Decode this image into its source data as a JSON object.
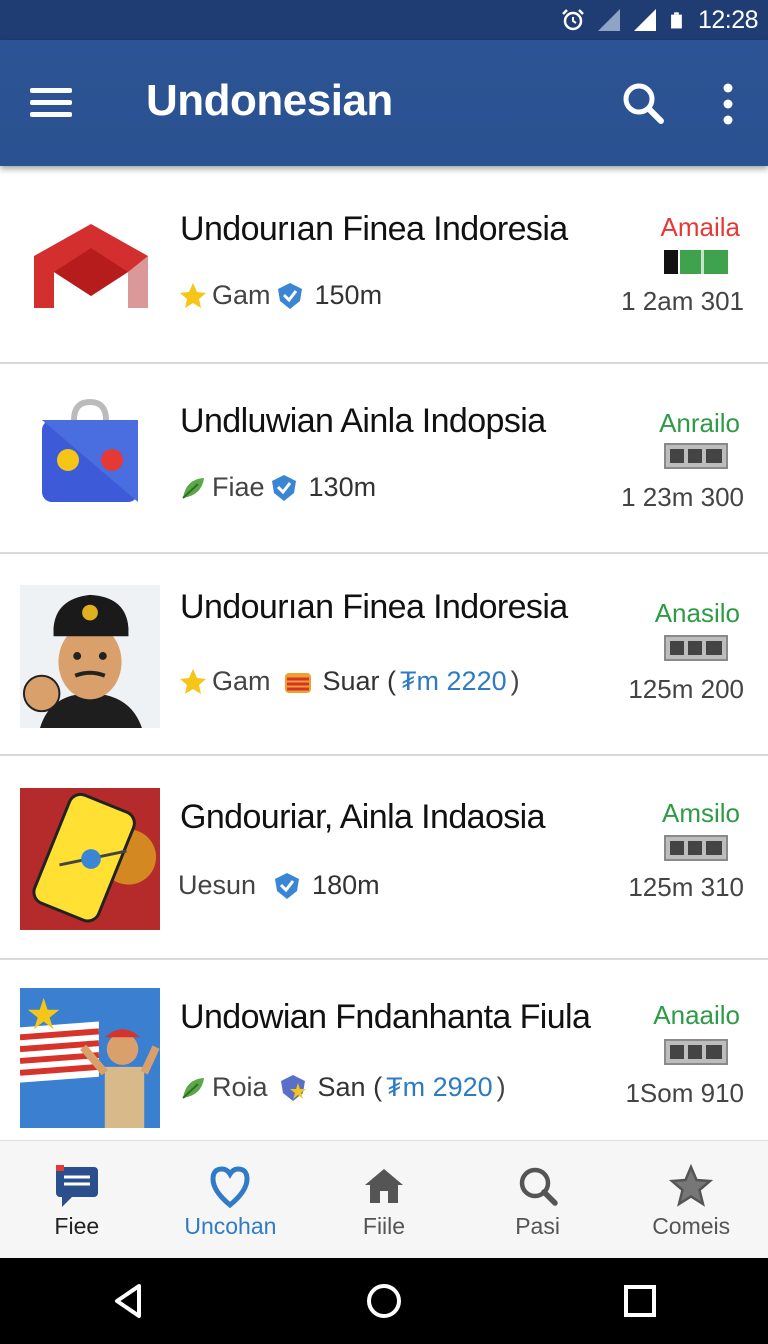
{
  "status_bar": {
    "time": "12:28"
  },
  "app_bar": {
    "title": "Undonesian"
  },
  "colors": {
    "app_bar": "#2a5190",
    "status_bar": "#1f3c73",
    "status_red": "#e53935",
    "status_green": "#2e9b46",
    "nav_selected": "#2f7bc8"
  },
  "items": [
    {
      "title": "Undourıan Finea Indoresia",
      "meta_left_icon": "star-icon",
      "meta_left_text": "Gam",
      "meta_mid_icon": "verified-check-icon",
      "meta_count": "150m",
      "meta_extra": "",
      "status": "Amaila",
      "status_color": "#e53935",
      "sizes": "1 2am 301",
      "thumb_icon": "red-envelope-icon"
    },
    {
      "title": "Undluwian Ainla Indopsia",
      "meta_left_icon": "leaf-icon",
      "meta_left_text": "Fiae",
      "meta_mid_icon": "verified-check-icon",
      "meta_count": "130m",
      "meta_extra": "",
      "status": "Anrailo",
      "status_color": "#2e9b46",
      "sizes": "1 23m 300",
      "thumb_icon": "blue-bag-icon"
    },
    {
      "title": "Undourıan Finea Indoresia",
      "meta_left_icon": "star-icon",
      "meta_left_text": "Gam",
      "meta_mid_icon": "flag-stripes-icon",
      "meta_count": "Suar (",
      "meta_extra": "₮m 2220",
      "meta_close": ")",
      "status": "Anasilo",
      "status_color": "#2e9b46",
      "sizes": "125m 200",
      "thumb_icon": "soldier-avatar-icon"
    },
    {
      "title": "Gndouriar, Ainla Indaosia",
      "meta_left_icon": "",
      "meta_left_text": "Uesun",
      "meta_mid_icon": "verified-check-icon",
      "meta_count": "180m",
      "meta_extra": "",
      "status": "Amsilo",
      "status_color": "#2e9b46",
      "sizes": "125m 310",
      "thumb_icon": "yellow-phone-icon"
    },
    {
      "title": "Undowian Fndanhanta Fiula",
      "meta_left_icon": "leaf-icon",
      "meta_left_text": "Roia",
      "meta_mid_icon": "verified-star-icon",
      "meta_count": "San (",
      "meta_extra": "₮m 2920",
      "meta_close": ")",
      "status": "Anaailo",
      "status_color": "#2e9b46",
      "sizes": "1Som 910",
      "thumb_icon": "flag-man-icon"
    }
  ],
  "bottom_nav": [
    {
      "label": "Fiee",
      "icon": "chat-icon"
    },
    {
      "label": "Uncohan",
      "icon": "heart-location-icon"
    },
    {
      "label": "Fiile",
      "icon": "home-icon"
    },
    {
      "label": "Pasi",
      "icon": "search-icon"
    },
    {
      "label": "Comeis",
      "icon": "star-outline-icon"
    }
  ]
}
